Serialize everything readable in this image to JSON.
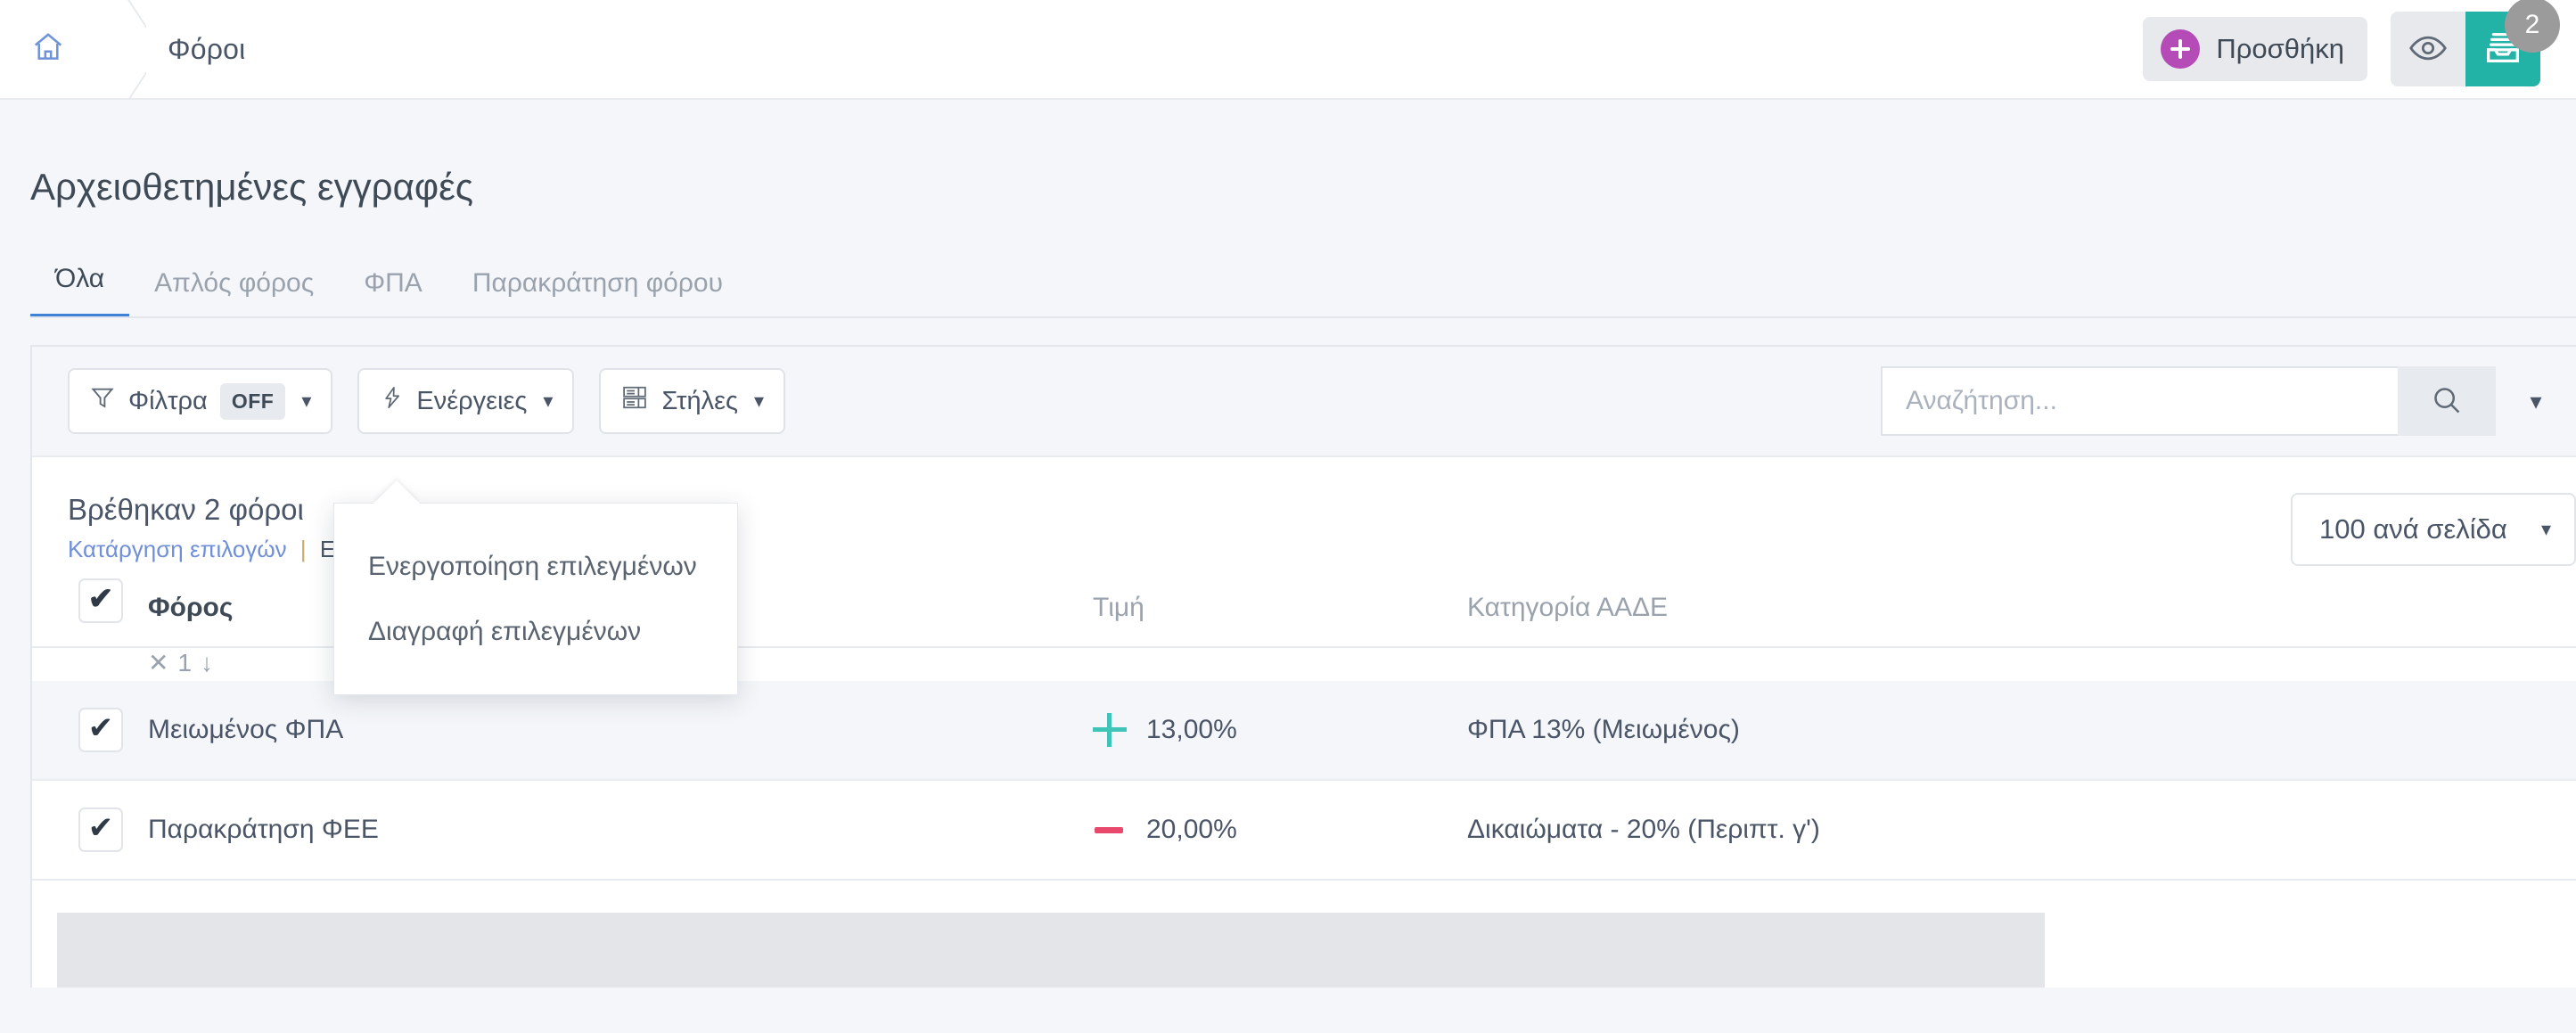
{
  "topbar": {
    "home_icon": "home-icon",
    "breadcrumb_label": "Φόροι",
    "add_button_label": "Προσθήκη",
    "add_icon": "plus-circle-icon",
    "preview_icon": "eye-icon",
    "archive_icon": "archive-inbox-icon",
    "archive_badge": "2",
    "accent_purple": "#b44bb7",
    "accent_teal": "#22b2a6",
    "badge_gray": "#9b9b9b"
  },
  "page": {
    "title": "Αρχειοθετημένες εγγραφές",
    "tabs": [
      {
        "label": "Όλα",
        "active": true
      },
      {
        "label": "Απλός φόρος",
        "active": false
      },
      {
        "label": "ΦΠΑ",
        "active": false
      },
      {
        "label": "Παρακράτηση φόρου",
        "active": false
      }
    ],
    "active_tab_color": "#3f82d6"
  },
  "toolbar": {
    "filters_label": "Φίλτρα",
    "filters_state": "OFF",
    "filters_icon": "funnel-icon",
    "actions_label": "Ενέργειες",
    "actions_icon": "lightning-bolt-icon",
    "columns_label": "Στήλες",
    "columns_icon": "columns-layout-icon",
    "caret": "▾"
  },
  "search": {
    "placeholder": "Αναζήτηση...",
    "value": "",
    "search_icon": "search-icon",
    "caret_icon": "chevron-down-icon"
  },
  "results": {
    "found_text": "Βρέθηκαν 2 φόροι",
    "clear_selection_link": "Κατάργηση επιλογών",
    "separator": "|",
    "second_link": "Επ",
    "per_page_label": "100 ανά σελίδα",
    "per_page_caret": "▾"
  },
  "actions_menu": {
    "items": [
      {
        "label": "Ενεργοποίηση επιλεγμένων"
      },
      {
        "label": "Διαγραφή επιλεγμένων"
      }
    ]
  },
  "table": {
    "sort_indicator": {
      "clear": "✕",
      "order": "1",
      "direction": "↓"
    },
    "columns": [
      {
        "key": "name",
        "label": "Φόρος",
        "bold": true
      },
      {
        "key": "value",
        "label": "Τιμή",
        "bold": false
      },
      {
        "key": "category",
        "label": "Κατηγορία ΑΑΔΕ",
        "bold": false
      }
    ],
    "rows": [
      {
        "checked": true,
        "name": "Μειωμένος ΦΠΑ",
        "sign": "plus",
        "value": "13,00%",
        "category": "ΦΠΑ 13% (Μειωμένος)"
      },
      {
        "checked": true,
        "name": "Παρακράτηση ΦΕΕ",
        "sign": "minus",
        "value": "20,00%",
        "category": "Δικαιώματα - 20% (Περιπτ. γ')"
      }
    ],
    "sign_plus_color": "#3fc4b8",
    "sign_minus_color": "#e8486b",
    "checkmark": "✔"
  }
}
